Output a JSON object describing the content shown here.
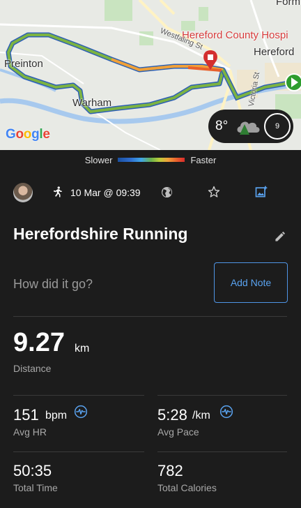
{
  "map": {
    "places": {
      "preinton": "Preinton",
      "warham": "Warham",
      "hereford": "Hereford",
      "hospital": "Hereford County Hospi",
      "form": "Form",
      "westfaling": "Westfaling St",
      "victoria": "Victoria St"
    },
    "attribution": "Google",
    "weather": {
      "temp": "8°",
      "wind_speed": "9"
    }
  },
  "legend": {
    "slower": "Slower",
    "faster": "Faster"
  },
  "activity": {
    "date": "10 Mar @ 09:39",
    "title": "Herefordshire Running"
  },
  "note": {
    "prompt": "How did it go?",
    "button": "Add Note"
  },
  "stats": {
    "distance": {
      "value": "9.27",
      "unit": "km",
      "label": "Distance"
    },
    "avg_hr": {
      "value": "151",
      "unit": "bpm",
      "label": "Avg HR"
    },
    "avg_pace": {
      "value": "5:28",
      "unit": "/km",
      "label": "Avg Pace"
    },
    "total_time": {
      "value": "50:35",
      "label": "Total Time"
    },
    "total_calories": {
      "value": "782",
      "label": "Total Calories"
    }
  },
  "colors": {
    "background": "#1c1c1c",
    "accent": "#5aa3f0",
    "route_green": "#6ab04c",
    "route_fast": "#e8602c",
    "end_marker": "#d32f2f",
    "start_marker": "#2e9d2e"
  }
}
